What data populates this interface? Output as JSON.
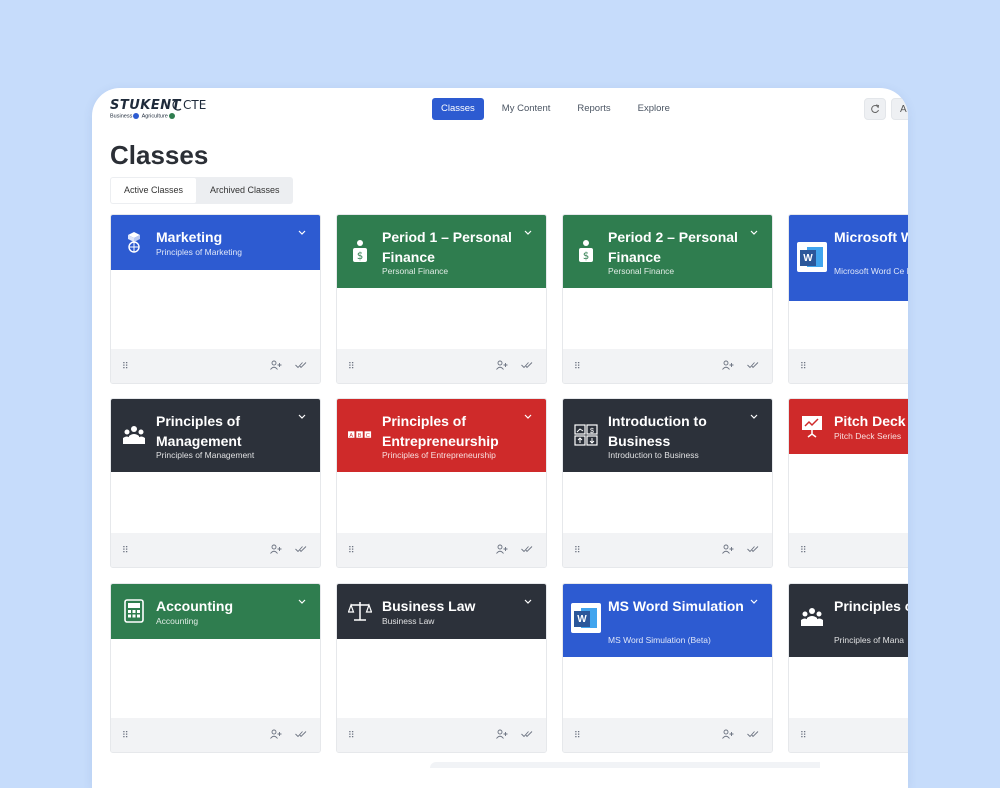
{
  "brand": {
    "name": "STUKENT",
    "suffix": "CTE",
    "sub_business": "Business",
    "sub_agriculture": "Agriculture"
  },
  "nav": [
    {
      "label": "Classes",
      "active": true
    },
    {
      "label": "My Content"
    },
    {
      "label": "Reports"
    },
    {
      "label": "Explore"
    }
  ],
  "header": {
    "refresh_icon": "refresh-icon",
    "user_initial": "A"
  },
  "page": {
    "title": "Classes"
  },
  "tabs": [
    {
      "label": "Active Classes",
      "active": true
    },
    {
      "label": "Archived Classes"
    }
  ],
  "colors": {
    "blue": "#2d5bd1",
    "green": "#2f7d4f",
    "dark": "#2c313a",
    "red": "#cf2a2a",
    "accent": "#2d5bd1",
    "page_bg": "#c6dcfb"
  },
  "cards": [
    {
      "title": "Marketing",
      "subtitle": "Principles of Marketing",
      "color": "blue",
      "icon": "globe-cube-icon"
    },
    {
      "title": "Period 1 – Personal Finance",
      "subtitle": "Personal Finance",
      "color": "green",
      "icon": "person-dollar-icon"
    },
    {
      "title": "Period 2 – Personal Finance",
      "subtitle": "Personal Finance",
      "color": "green",
      "icon": "person-dollar-icon"
    },
    {
      "title": "Microsoft W Certification",
      "subtitle": "Microsoft Word Ce Prep",
      "color": "blue",
      "icon": "word-icon"
    },
    {
      "title": "Principles of Management",
      "subtitle": "Principles of Management",
      "color": "dark",
      "icon": "team-icon"
    },
    {
      "title": "Principles of Entrepreneurship",
      "subtitle": "Principles of Entrepreneurship",
      "color": "red",
      "icon": "abc-blocks-icon"
    },
    {
      "title": "Introduction to Business",
      "subtitle": "Introduction to Business",
      "color": "dark",
      "icon": "chart-dollar-icon"
    },
    {
      "title": "Pitch Deck S",
      "subtitle": "Pitch Deck Series",
      "color": "red",
      "icon": "presentation-icon"
    },
    {
      "title": "Accounting",
      "subtitle": "Accounting",
      "color": "green",
      "icon": "calculator-icon"
    },
    {
      "title": "Business Law",
      "subtitle": "Business Law",
      "color": "dark",
      "icon": "scales-icon"
    },
    {
      "title": "MS Word Simulation",
      "subtitle": "MS Word Simulation (Beta)",
      "color": "blue",
      "icon": "word-icon"
    },
    {
      "title": "Principles o Managment",
      "subtitle": "Principles of Mana",
      "color": "dark",
      "icon": "team-icon"
    }
  ],
  "card_actions": {
    "grip": "⠿",
    "add_student": "add-student-icon",
    "grade": "double-check-icon"
  }
}
